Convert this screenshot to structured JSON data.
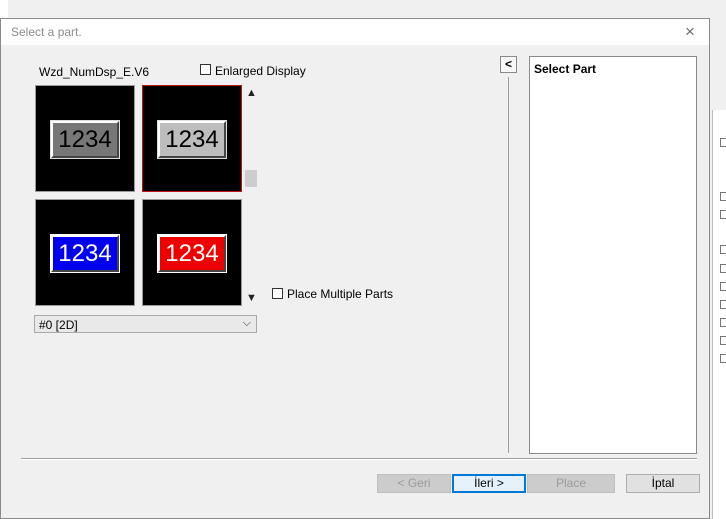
{
  "dialog": {
    "title": "Select a part.",
    "part_name": "Wzd_NumDsp_E.V6",
    "enlarged_display_label": "Enlarged Display",
    "place_multiple_label": "Place Multiple Parts",
    "combo_value": "#0 [2D]",
    "select_part_title": "Select Part",
    "collapse_glyph": "<",
    "close_glyph": "×"
  },
  "tiles": [
    {
      "text": "1234",
      "bg": "#777777",
      "fg": "#000000",
      "selected": false
    },
    {
      "text": "1234",
      "bg": "#bdbdbd",
      "fg": "#000000",
      "selected": true
    },
    {
      "text": "1234",
      "bg": "#0000ee",
      "fg": "#ffffff",
      "selected": false
    },
    {
      "text": "1234",
      "bg": "#ee0000",
      "fg": "#ffffff",
      "selected": false
    }
  ],
  "buttons": {
    "back": "< Geri",
    "next": "İleri >",
    "place": "Place",
    "cancel": "İptal"
  },
  "colors": {
    "selected_border": "#c21212",
    "primary_border": "#0078d7"
  }
}
